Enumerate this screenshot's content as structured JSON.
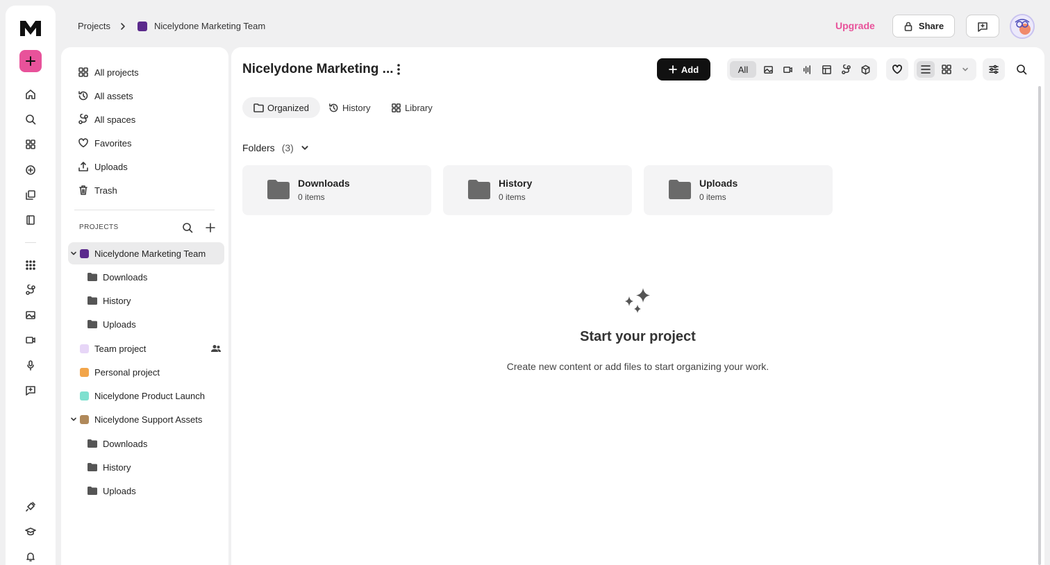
{
  "breadcrumb": {
    "root": "Projects",
    "current": "Nicelydone Marketing Team",
    "current_color": "#5b2a8c"
  },
  "topbar": {
    "upgrade": "Upgrade",
    "share": "Share"
  },
  "sidebar": {
    "nav": [
      {
        "label": "All projects",
        "icon": "grid-icon"
      },
      {
        "label": "All assets",
        "icon": "history-icon"
      },
      {
        "label": "All spaces",
        "icon": "spaces-icon"
      },
      {
        "label": "Favorites",
        "icon": "heart-icon"
      },
      {
        "label": "Uploads",
        "icon": "upload-icon"
      },
      {
        "label": "Trash",
        "icon": "trash-icon"
      }
    ],
    "projects_heading": "PROJECTS",
    "projects": [
      {
        "name": "Nicelydone Marketing Team",
        "color": "#5b2a8c",
        "expanded": true,
        "active": true,
        "folders": [
          "Downloads",
          "History",
          "Uploads"
        ]
      },
      {
        "name": "Team project",
        "color": "#e7d6f7",
        "shared": true
      },
      {
        "name": "Personal project",
        "color": "#f2a54a"
      },
      {
        "name": "Nicelydone Product Launch",
        "color": "#7fe0cf"
      },
      {
        "name": "Nicelydone Support Assets",
        "color": "#b0895a",
        "expanded": true,
        "folders": [
          "Downloads",
          "History",
          "Uploads"
        ]
      }
    ]
  },
  "main": {
    "title": "Nicelydone Marketing ...",
    "add_label": "Add",
    "filter_all": "All",
    "tabs": [
      {
        "label": "Organized",
        "active": true
      },
      {
        "label": "History"
      },
      {
        "label": "Library"
      }
    ],
    "folders_heading": "Folders",
    "folders_count": "(3)",
    "folders": [
      {
        "name": "Downloads",
        "count": "0 items"
      },
      {
        "name": "History",
        "count": "0 items"
      },
      {
        "name": "Uploads",
        "count": "0 items"
      }
    ],
    "empty_title": "Start your project",
    "empty_desc": "Create new content or add files to start organizing your work."
  },
  "colors": {
    "accent": "#e8529a",
    "primary_button": "#111111"
  }
}
